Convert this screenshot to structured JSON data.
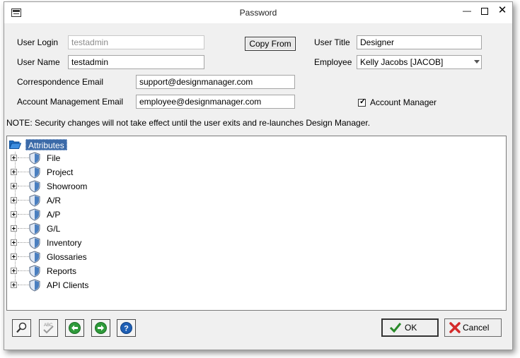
{
  "window": {
    "title": "Password"
  },
  "form": {
    "user_login_label": "User Login",
    "user_login_value": "testadmin",
    "user_name_label": "User Name",
    "user_name_value": "testadmin",
    "copy_from_label": "Copy From",
    "user_title_label": "User Title",
    "user_title_value": "Designer",
    "employee_label": "Employee",
    "employee_value": "Kelly Jacobs [JACOB]",
    "correspondence_email_label": "Correspondence Email",
    "correspondence_email_value": "support@designmanager.com",
    "account_mgmt_email_label": "Account Management Email",
    "account_mgmt_email_value": "employee@designmanager.com",
    "account_manager_label": "Account Manager",
    "account_manager_checked": true
  },
  "note": "NOTE: Security changes will not take effect until the user exits and re-launches Design Manager.",
  "tree": {
    "root_label": "Attributes",
    "nodes": [
      "File",
      "Project",
      "Showroom",
      "A/R",
      "A/P",
      "G/L",
      "Inventory",
      "Glossaries",
      "Reports",
      "API Clients"
    ]
  },
  "buttons": {
    "ok_label": "OK",
    "cancel_label": "Cancel"
  },
  "icons": {
    "toolbar": [
      "magnifier-icon",
      "spellcheck-icon",
      "arrow-left-icon",
      "arrow-right-icon",
      "help-icon"
    ],
    "ok_icon": "checkmark-icon",
    "cancel_icon": "red-x-icon",
    "node_icon": "shield-icon",
    "root_icon": "folder-open-icon"
  },
  "colors": {
    "selection": "#3b6aa8",
    "shield": "#4a7fc0",
    "nav_green": "#2e9a3a",
    "help_blue": "#1e5fb5",
    "cancel_red": "#d42a2a",
    "ok_green": "#2a8a2a"
  }
}
